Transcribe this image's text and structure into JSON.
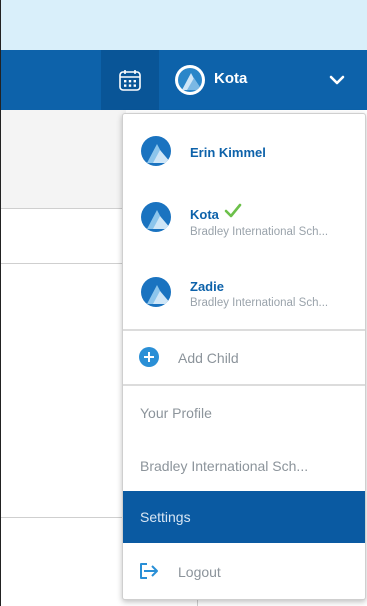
{
  "header": {
    "current_child": "Kota"
  },
  "icons": {
    "calendar": "calendar-icon",
    "chevron": "chevron-down-icon",
    "check": "check-icon",
    "add": "plus-circle-icon",
    "logout": "logout-icon"
  },
  "colors": {
    "brand_blue": "#0d62aa",
    "header_blue": "#0d62aa",
    "selected_blue": "#0a5aa2",
    "top_strip": "#d9effa",
    "check_green": "#6cc04a",
    "muted_text": "#8c949b"
  },
  "dropdown": {
    "parent": {
      "name": "Erin Kimmel"
    },
    "children": [
      {
        "name": "Kota",
        "school": "Bradley International Sch...",
        "selected": true
      },
      {
        "name": "Zadie",
        "school": "Bradley International Sch...",
        "selected": false
      }
    ],
    "add_child_label": "Add Child",
    "your_profile_label": "Your Profile",
    "school_label": "Bradley International Sch...",
    "settings_label": "Settings",
    "logout_label": "Logout"
  }
}
